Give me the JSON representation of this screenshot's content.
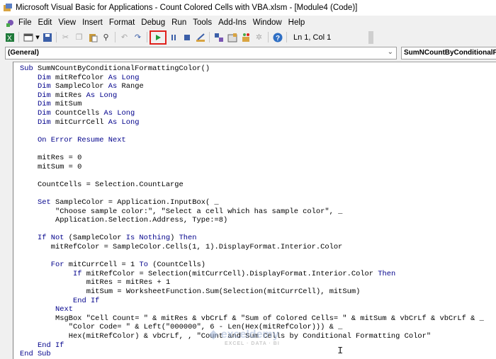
{
  "window": {
    "title": "Microsoft Visual Basic for Applications - Count Colored Cells with VBA.xlsm - [Module4 (Code)]"
  },
  "menu": [
    "File",
    "Edit",
    "View",
    "Insert",
    "Format",
    "Debug",
    "Run",
    "Tools",
    "Add-Ins",
    "Window",
    "Help"
  ],
  "toolbar": {
    "position": "Ln 1, Col 1",
    "highlight_color": "#e0201b"
  },
  "selectors": {
    "object": "(General)",
    "procedure": "SumNCountByConditionalFormattingColor"
  },
  "code": [
    [
      0,
      [
        [
          "Sub ",
          1
        ],
        [
          "SumNCountByConditionalFormattingColor()",
          0
        ]
      ]
    ],
    [
      4,
      [
        [
          "Dim ",
          1
        ],
        [
          "mitRefColor ",
          0
        ],
        [
          "As Long",
          1
        ]
      ]
    ],
    [
      4,
      [
        [
          "Dim ",
          1
        ],
        [
          "SampleColor ",
          0
        ],
        [
          "As ",
          1
        ],
        [
          "Range",
          0
        ]
      ]
    ],
    [
      4,
      [
        [
          "Dim ",
          1
        ],
        [
          "mitRes ",
          0
        ],
        [
          "As Long",
          1
        ]
      ]
    ],
    [
      4,
      [
        [
          "Dim ",
          1
        ],
        [
          "mitSum",
          0
        ]
      ]
    ],
    [
      4,
      [
        [
          "Dim ",
          1
        ],
        [
          "CountCells ",
          0
        ],
        [
          "As Long",
          1
        ]
      ]
    ],
    [
      4,
      [
        [
          "Dim ",
          1
        ],
        [
          "mitCurrCell ",
          0
        ],
        [
          "As Long",
          1
        ]
      ]
    ],
    [
      0,
      []
    ],
    [
      4,
      [
        [
          "On Error Resume Next",
          1
        ]
      ]
    ],
    [
      0,
      []
    ],
    [
      4,
      [
        [
          "mitRes = 0",
          0
        ]
      ]
    ],
    [
      4,
      [
        [
          "mitSum = 0",
          0
        ]
      ]
    ],
    [
      0,
      []
    ],
    [
      4,
      [
        [
          "CountCells = Selection.CountLarge",
          0
        ]
      ]
    ],
    [
      0,
      []
    ],
    [
      4,
      [
        [
          "Set ",
          1
        ],
        [
          "SampleColor = Application.InputBox( _",
          0
        ]
      ]
    ],
    [
      8,
      [
        [
          "\"Choose sample color:\", \"Select a cell which has sample color\", _",
          0
        ]
      ]
    ],
    [
      8,
      [
        [
          "Application.Selection.Address, Type:=8)",
          0
        ]
      ]
    ],
    [
      0,
      []
    ],
    [
      4,
      [
        [
          "If Not ",
          1
        ],
        [
          "(SampleColor ",
          0
        ],
        [
          "Is Nothing",
          1
        ],
        [
          ") ",
          0
        ],
        [
          "Then",
          1
        ]
      ]
    ],
    [
      7,
      [
        [
          "mitRefColor = SampleColor.Cells(1, 1).DisplayFormat.Interior.Color",
          0
        ]
      ]
    ],
    [
      0,
      []
    ],
    [
      7,
      [
        [
          "For ",
          1
        ],
        [
          "mitCurrCell = 1 ",
          0
        ],
        [
          "To ",
          1
        ],
        [
          "(CountCells)",
          0
        ]
      ]
    ],
    [
      12,
      [
        [
          "If ",
          1
        ],
        [
          "mitRefColor = Selection(mitCurrCell).DisplayFormat.Interior.Color ",
          0
        ],
        [
          "Then",
          1
        ]
      ]
    ],
    [
      15,
      [
        [
          "mitRes = mitRes + 1",
          0
        ]
      ]
    ],
    [
      15,
      [
        [
          "mitSum = WorksheetFunction.Sum(Selection(mitCurrCell), mitSum)",
          0
        ]
      ]
    ],
    [
      12,
      [
        [
          "End If",
          1
        ]
      ]
    ],
    [
      8,
      [
        [
          "Next",
          1
        ]
      ]
    ],
    [
      8,
      [
        [
          "MsgBox \"Cell Count= \" & mitRes & vbCrLf & \"Sum of Colored Cells= \" & mitSum & vbCrLf & vbCrLf & _",
          0
        ]
      ]
    ],
    [
      11,
      [
        [
          "\"Color Code= \" & Left(\"000000\", 6 - Len(Hex(mitRefColor))) & _",
          0
        ]
      ]
    ],
    [
      11,
      [
        [
          "Hex(mitRefColor) & vbCrLf, , \"Count and Sum Cells by Conditional Formatting Color\"",
          0
        ]
      ]
    ],
    [
      4,
      [
        [
          "End If",
          1
        ]
      ]
    ],
    [
      0,
      [
        [
          "End Sub",
          1
        ]
      ]
    ]
  ],
  "watermark": {
    "brand": "exceldemy",
    "tagline": "EXCEL · DATA · BI"
  }
}
